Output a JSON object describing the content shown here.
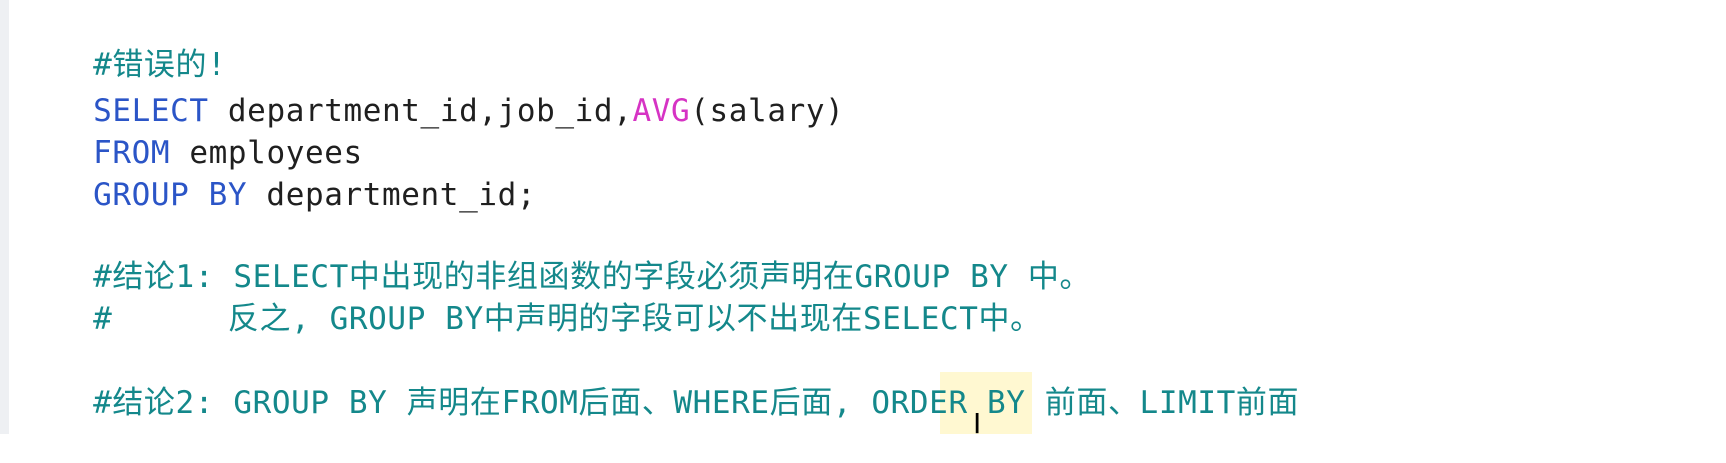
{
  "editor": {
    "lines": [
      {
        "segments": [
          {
            "text": "#错误的!",
            "type": "comment"
          }
        ]
      },
      {
        "segments": [
          {
            "text": "SELECT",
            "type": "keyword"
          },
          {
            "text": " department_id,job_id,",
            "type": "text"
          },
          {
            "text": "AVG",
            "type": "function"
          },
          {
            "text": "(salary)",
            "type": "text"
          }
        ]
      },
      {
        "segments": [
          {
            "text": "FROM",
            "type": "keyword"
          },
          {
            "text": " employees",
            "type": "text"
          }
        ]
      },
      {
        "segments": [
          {
            "text": "GROUP BY",
            "type": "keyword"
          },
          {
            "text": " department_id;",
            "type": "text"
          }
        ]
      },
      {
        "segments": []
      },
      {
        "segments": [
          {
            "text": "#结论1: SELECT中出现的非组函数的字段必须声明在GROUP BY 中。",
            "type": "comment"
          }
        ]
      },
      {
        "segments": [
          {
            "text": "#      反之, GROUP BY中声明的字段可以不出现在SELECT中。",
            "type": "comment"
          }
        ]
      },
      {
        "segments": []
      },
      {
        "segments": [
          {
            "text": "#结论2: GROUP BY 声明在FROM后面、WHERE后面, ORDER BY 前面、LIMIT前面",
            "type": "comment"
          }
        ]
      }
    ]
  },
  "colors": {
    "keyword": "#2b55c7",
    "function": "#d633c4",
    "comment": "#14888b",
    "text": "#1f1f1f",
    "background": "#ffffff"
  },
  "cursor": {
    "icon": "text-cursor-icon",
    "glyph": "I"
  }
}
